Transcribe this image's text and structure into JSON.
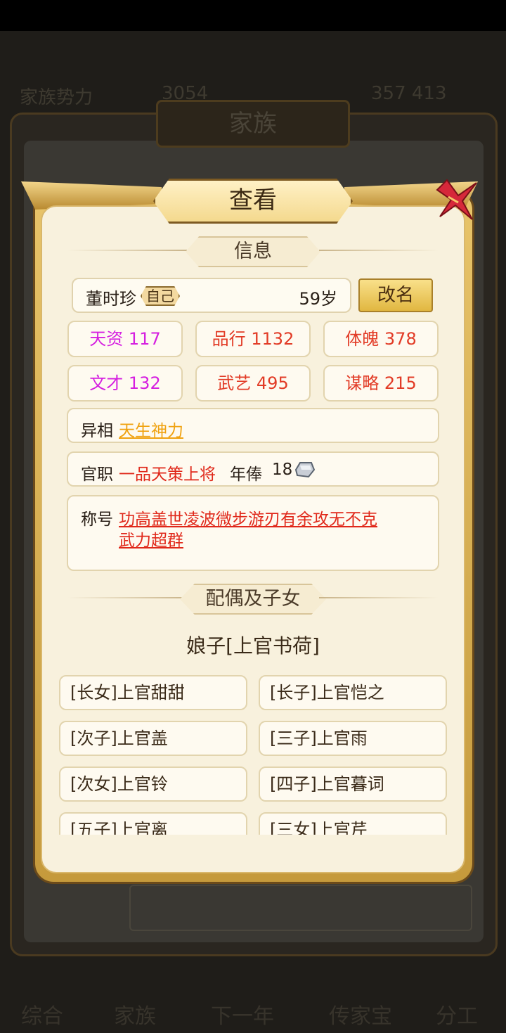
{
  "background": {
    "topbar_left": "家族势力",
    "topbar_mid": "3054",
    "topbar_right": "357 413",
    "panel_title": "家族",
    "bottom_nav": [
      "综合",
      "家族",
      "下一年",
      "传家宝",
      "分工"
    ]
  },
  "dialog": {
    "title": "查看",
    "info_section": "信息",
    "name": "董时珍",
    "self_badge": "自己",
    "age": "59岁",
    "rename_label": "改名",
    "stats": [
      {
        "label": "天资 117",
        "color": "purple"
      },
      {
        "label": "品行 1132",
        "color": "red"
      },
      {
        "label": "体魄 378",
        "color": "red"
      },
      {
        "label": "文才 132",
        "color": "purple"
      },
      {
        "label": "武艺 495",
        "color": "red"
      },
      {
        "label": "谋略 215",
        "color": "red"
      }
    ],
    "trait_label": "异相",
    "trait_value": "天生神力",
    "office_label": "官职",
    "office_value": "一品天策上将",
    "salary_label": "年俸",
    "salary_value": "18",
    "titles_label": "称号",
    "titles_line1": "功高盖世凌波微步游刃有余攻无不克",
    "titles_line2": "武力超群",
    "family_section": "配偶及子女",
    "spouse": "娘子[上官书荷]",
    "children": [
      "[长女]上官甜甜",
      "[长子]上官恺之",
      "[次子]上官盖",
      "[三子]上官雨",
      "[次女]上官铃",
      "[四子]上官暮词",
      "[五子]上官离",
      "[三女]上官芹"
    ]
  }
}
